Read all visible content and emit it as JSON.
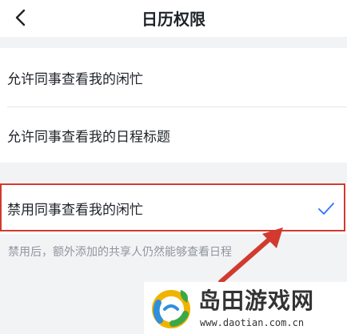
{
  "header": {
    "title": "日历权限"
  },
  "group1": {
    "items": [
      {
        "label": "允许同事查看我的闲忙"
      },
      {
        "label": "允许同事查看我的日程标题"
      }
    ]
  },
  "group2": {
    "items": [
      {
        "label": "禁用同事查看我的闲忙",
        "selected": true
      }
    ]
  },
  "hint": "禁用后，额外添加的共享人仍然能够查看日程",
  "watermark": {
    "brand": "岛田游戏网",
    "url": "www.daotian.com.cn"
  },
  "colors": {
    "accent": "#3370ff",
    "highlight": "#d23a2f",
    "arrow": "#d23a2f"
  },
  "icons": {
    "back": "chevron-left-icon",
    "check": "check-icon"
  }
}
